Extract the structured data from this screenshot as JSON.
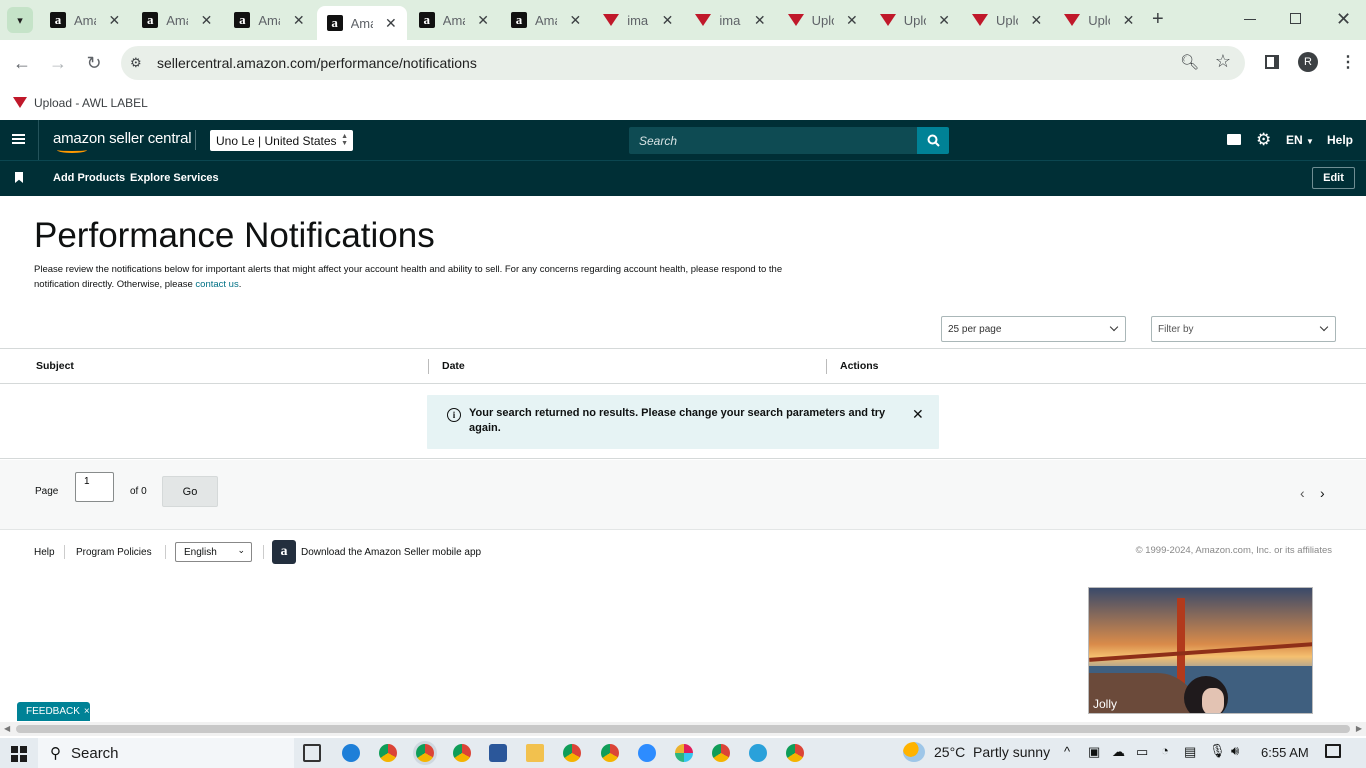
{
  "browser": {
    "tabs": [
      {
        "title": "Ama",
        "favicon": "amazon-icon"
      },
      {
        "title": "Ama",
        "favicon": "amazon-icon"
      },
      {
        "title": "Ama",
        "favicon": "amazon-icon"
      },
      {
        "title": "Ama",
        "favicon": "amazon-icon",
        "active": true
      },
      {
        "title": "Ama",
        "favicon": "amazon-icon"
      },
      {
        "title": "Ama",
        "favicon": "amazon-icon"
      },
      {
        "title": "ima",
        "favicon": "awl-icon"
      },
      {
        "title": "ima",
        "favicon": "awl-icon"
      },
      {
        "title": "Uplo",
        "favicon": "awl-icon"
      },
      {
        "title": "Uplo",
        "favicon": "awl-icon"
      },
      {
        "title": "Uplo",
        "favicon": "awl-icon"
      },
      {
        "title": "Uplo",
        "favicon": "awl-icon"
      }
    ],
    "url": "sellercentral.amazon.com/performance/notifications",
    "profile_initial": "R",
    "bookmark": "Upload - AWL LABEL"
  },
  "header": {
    "logo": "amazon seller central",
    "account": "Uno Le | United States",
    "search_placeholder": "Search",
    "language": "EN",
    "help": "Help"
  },
  "subnav": {
    "items": [
      "Add Products",
      "Explore Services"
    ],
    "edit": "Edit"
  },
  "page": {
    "title": "Performance Notifications",
    "description_1": "Please review the notifications below for important alerts that might affect your account health and ability to sell. For any concerns regarding account health, please respond to the",
    "description_2": "notification directly. Otherwise, please",
    "contact_link": "contact us",
    "description_end": ".",
    "per_page": "25 per page",
    "filter": "Filter by",
    "columns": [
      "Subject",
      "Date",
      "Actions"
    ],
    "alert": "Your search returned no results. Please change your search parameters and try again.",
    "pagination": {
      "label": "Page",
      "value": "1",
      "of": "of 0",
      "go": "Go"
    }
  },
  "footer": {
    "help": "Help",
    "policies": "Program Policies",
    "language": "English",
    "app": "Download the Amazon Seller mobile app",
    "copyright": "© 1999-2024, Amazon.com, Inc. or its affiliates"
  },
  "video": {
    "name": "Jolly"
  },
  "feedback": "FEEDBACK",
  "taskbar": {
    "search": "Search",
    "weather": "25°C  Partly sunny",
    "time": "6:55 AM"
  },
  "colors": {
    "header_bg": "#002f36",
    "search_btn": "#008296",
    "link": "#007185",
    "alert_bg": "#e6f3f4"
  }
}
